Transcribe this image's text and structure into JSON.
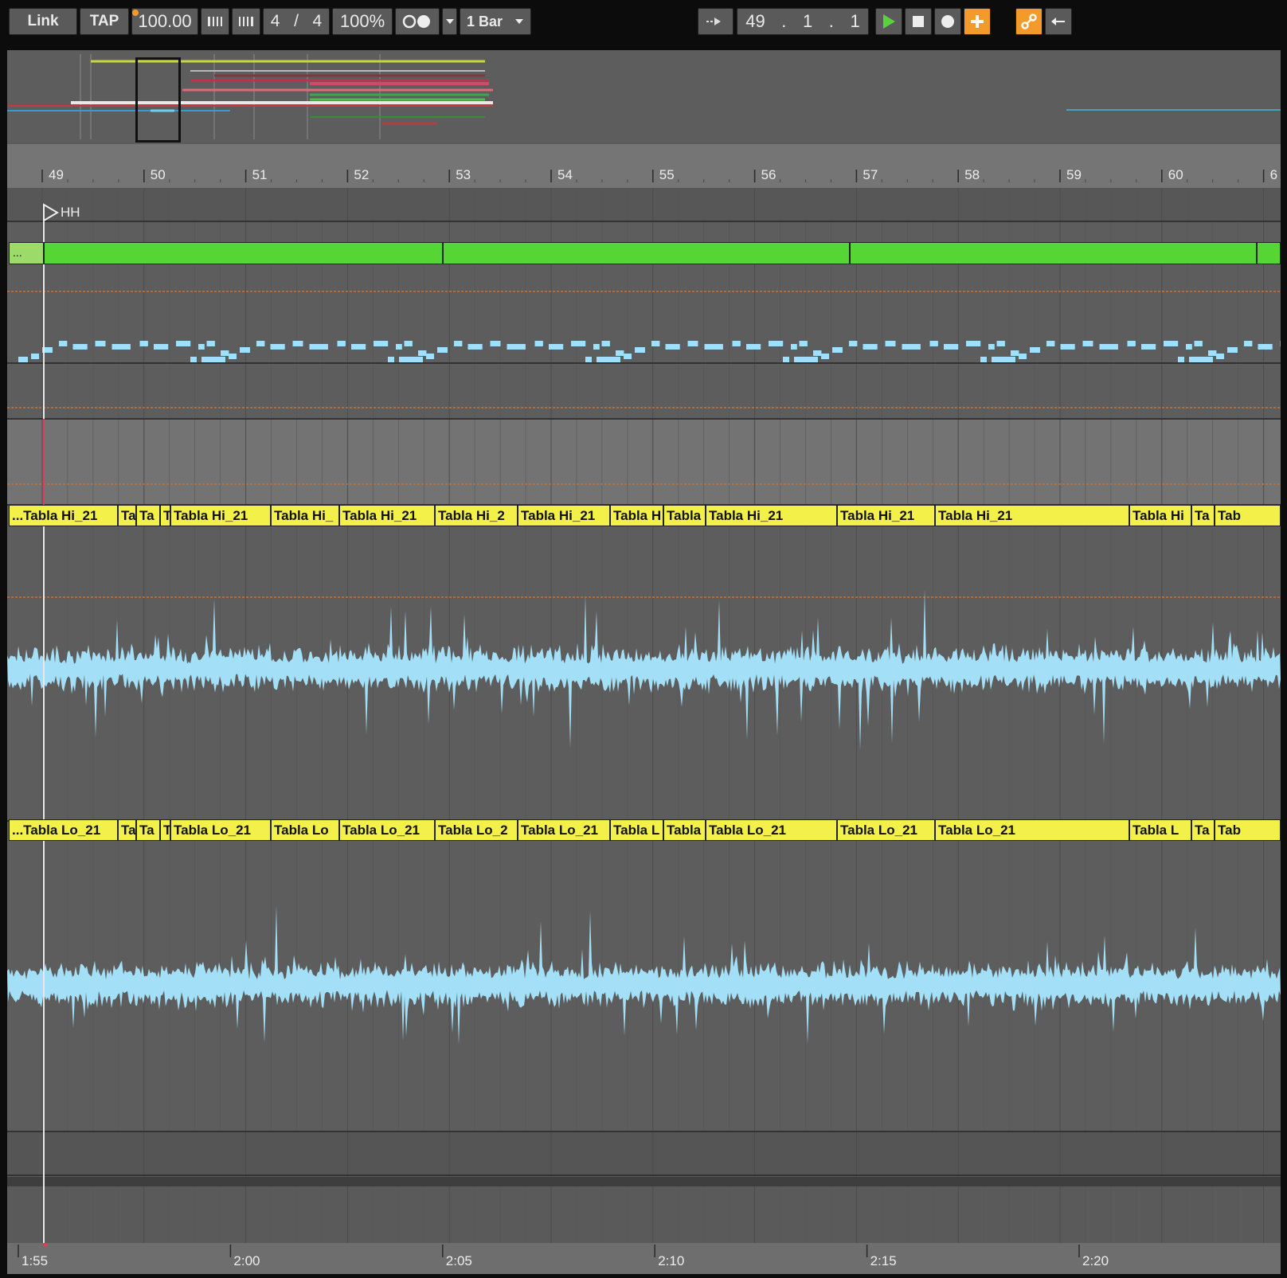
{
  "toolbar": {
    "link_label": "Link",
    "tap_label": "TAP",
    "tempo": "100.00",
    "sig_num": "4",
    "sig_sep": "/",
    "sig_den": "4",
    "zoom": "100%",
    "quantize": "1 Bar",
    "position": {
      "bar": "49",
      "beat": "1",
      "sixteenth": "1"
    }
  },
  "locator": {
    "label": "HH"
  },
  "bar_ruler": {
    "labels": [
      "49",
      "50",
      "51",
      "52",
      "53",
      "54",
      "55",
      "56",
      "57",
      "58",
      "59",
      "60",
      "6"
    ]
  },
  "time_ruler": {
    "labels": [
      "1:55",
      "2:00",
      "2:05",
      "2:10",
      "2:15",
      "2:20"
    ]
  },
  "tracks": {
    "midi_clip": {
      "label": "...",
      "color": "#55d635"
    },
    "hi_clips": [
      "...Tabla Hi_21",
      "Ta",
      "Ta",
      "T",
      "Tabla Hi_21",
      "Tabla Hi_",
      "Tabla Hi_21",
      "Tabla Hi_2",
      "Tabla Hi_21",
      "Tabla H",
      "Tabla",
      "Tabla Hi_21",
      "Tabla Hi_21",
      "Tabla Hi_21",
      "Tabla Hi",
      "Ta",
      "Tab"
    ],
    "lo_clips": [
      "...Tabla Lo_21",
      "Ta",
      "Ta",
      "T",
      "Tabla Lo_21",
      "Tabla Lo",
      "Tabla Lo_21",
      "Tabla Lo_2",
      "Tabla Lo_21",
      "Tabla L",
      "Tabla",
      "Tabla Lo_21",
      "Tabla Lo_21",
      "Tabla Lo_21",
      "Tabla L",
      "Ta",
      "Tab"
    ],
    "clip_color": "#f3f04a",
    "waveform_color": "#a6e6ff",
    "note_color": "#9fe0ff"
  },
  "colors": {
    "play": "#5ad23c",
    "orange": "#f39a2a"
  },
  "icons": [
    "metronome-icon",
    "grid-icon",
    "loop-icon",
    "follow-icon",
    "play-icon",
    "stop-icon",
    "record-icon",
    "add-icon",
    "automation-link-icon",
    "back-arrow-icon",
    "dropdown-icon",
    "locator-flag-icon"
  ]
}
